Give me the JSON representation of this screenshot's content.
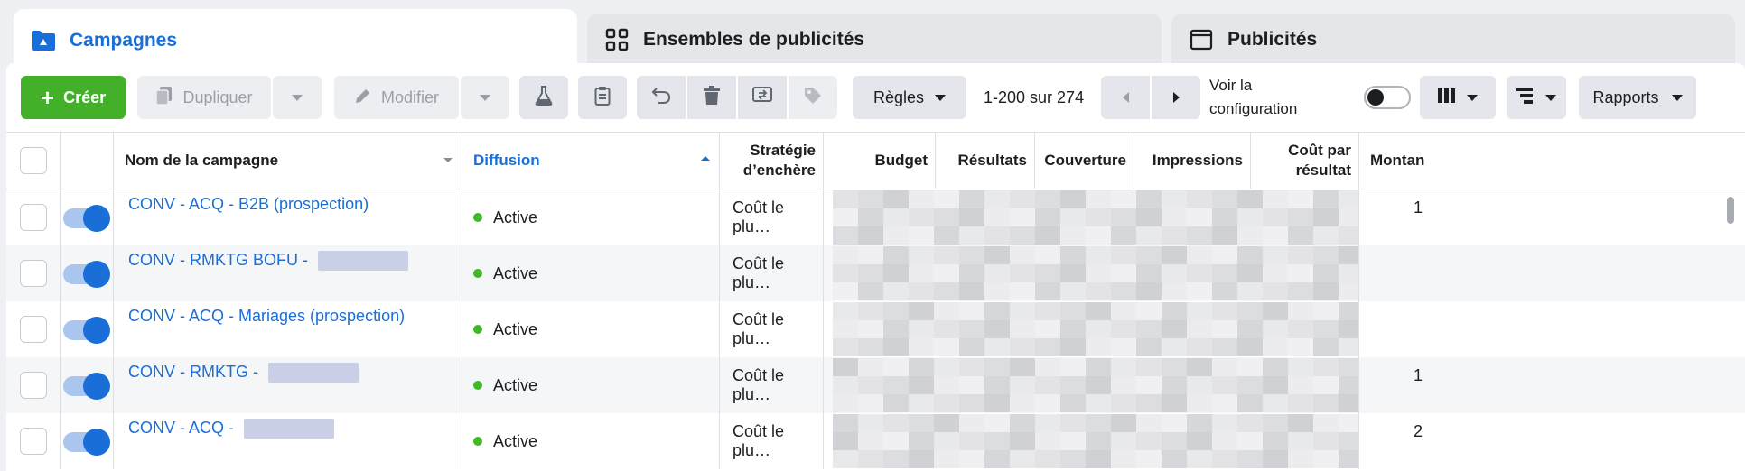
{
  "tabs": {
    "campagnes": "Campagnes",
    "ensembles": "Ensembles de publicités",
    "publicites": "Publicités"
  },
  "toolbar": {
    "create": "Créer",
    "duplicate": "Dupliquer",
    "edit": "Modifier",
    "rules": "Règles",
    "pager": "1-200 sur 274",
    "view_config": "Voir la configuration",
    "reports": "Rapports"
  },
  "columns": {
    "name": "Nom de la campagne",
    "delivery": "Diffusion",
    "bid_strategy": "Stratégie d’enchère",
    "budget": "Budget",
    "results": "Résultats",
    "reach": "Couverture",
    "impressions": "Impressions",
    "cost_per_result": "Coût par résultat",
    "amount": "Montan"
  },
  "rows": [
    {
      "name": "CONV - ACQ - B2B (prospection)",
      "delivery": "Active",
      "bid": "Coût le plu…",
      "amount_fragment": "1"
    },
    {
      "name": "CONV - RMKTG BOFU - ",
      "delivery": "Active",
      "bid": "Coût le plu…",
      "amount_fragment": ""
    },
    {
      "name": "CONV - ACQ - Mariages (prospection)",
      "delivery": "Active",
      "bid": "Coût le plu…",
      "amount_fragment": ""
    },
    {
      "name": "CONV - RMKTG - ",
      "delivery": "Active",
      "bid": "Coût le plu…",
      "amount_fragment": "1"
    },
    {
      "name": "CONV - ACQ - ",
      "delivery": "Active",
      "bid": "Coût le plu…",
      "amount_fragment": "2"
    }
  ],
  "colors": {
    "accent": "#1a6ed8",
    "create_green": "#43b02a",
    "active_dot": "#42b72a"
  },
  "icons": {
    "campagnes": "folder-icon",
    "ensembles": "grid-icon",
    "publicites": "window-icon"
  }
}
